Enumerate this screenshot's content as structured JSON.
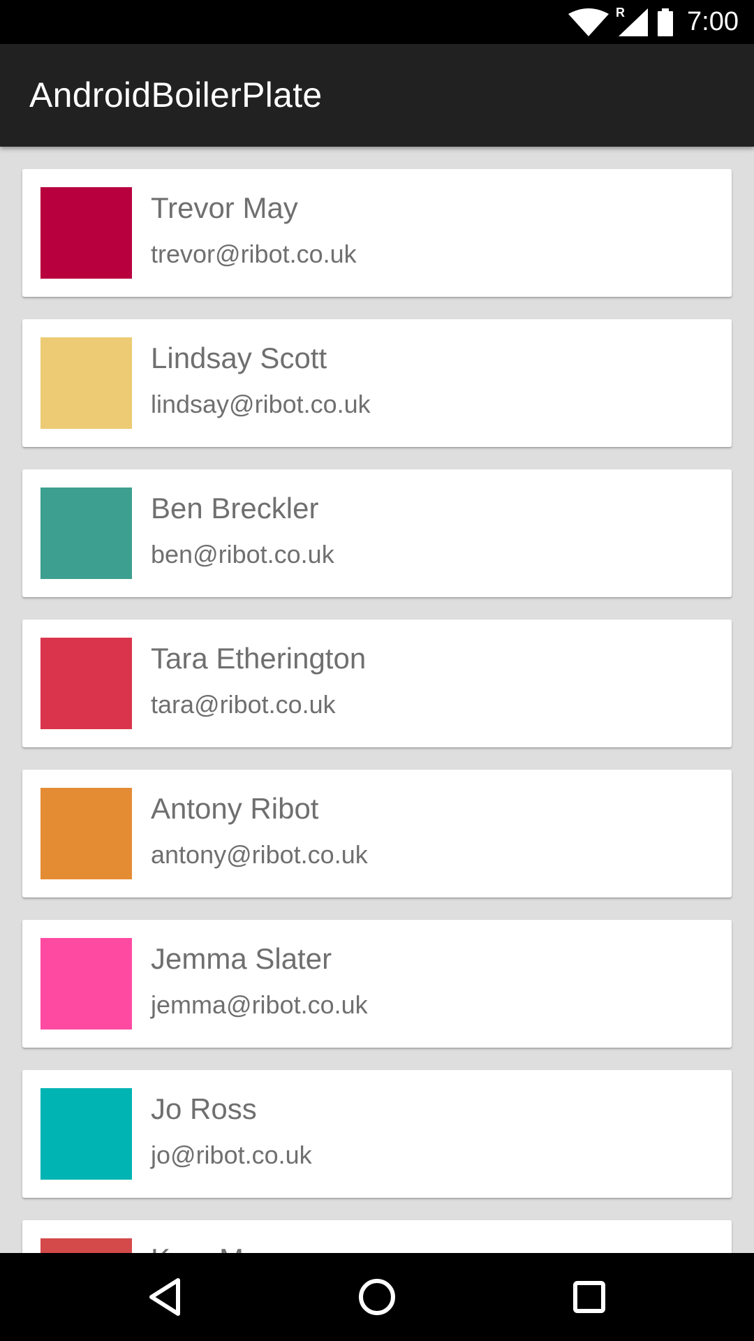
{
  "status_bar": {
    "time": "7:00",
    "roaming_indicator": "R",
    "icons": [
      "wifi-icon",
      "cell-signal-icon",
      "battery-icon"
    ]
  },
  "app_bar": {
    "title": "AndroidBoilerPlate"
  },
  "people": [
    {
      "name": "Trevor May",
      "email": "trevor@ribot.co.uk",
      "color": "#b8003f"
    },
    {
      "name": "Lindsay Scott",
      "email": "lindsay@ribot.co.uk",
      "color": "#eccb74"
    },
    {
      "name": "Ben Breckler",
      "email": "ben@ribot.co.uk",
      "color": "#3d9f8f"
    },
    {
      "name": "Tara Etherington",
      "email": "tara@ribot.co.uk",
      "color": "#da344c"
    },
    {
      "name": "Antony Ribot",
      "email": "antony@ribot.co.uk",
      "color": "#e38c34"
    },
    {
      "name": "Jemma Slater",
      "email": "jemma@ribot.co.uk",
      "color": "#ff4aa2"
    },
    {
      "name": "Jo Ross",
      "email": "jo@ribot.co.uk",
      "color": "#00b4b4"
    },
    {
      "name": "Ka... M...",
      "email": "",
      "color": "#d4494a"
    }
  ],
  "nav_bar": {
    "icons": [
      "back-icon",
      "home-icon",
      "recents-icon"
    ]
  }
}
